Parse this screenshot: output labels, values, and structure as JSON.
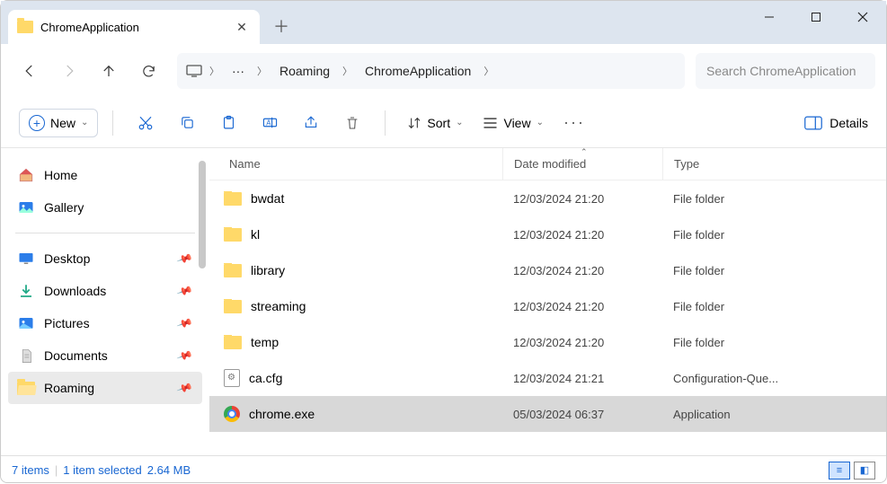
{
  "tab": {
    "title": "ChromeApplication"
  },
  "breadcrumbs": {
    "ellipsis": "···",
    "part1": "Roaming",
    "part2": "ChromeApplication"
  },
  "search": {
    "placeholder": "Search ChromeApplication"
  },
  "toolbar": {
    "new": "New",
    "sort": "Sort",
    "view": "View",
    "details": "Details"
  },
  "sidebar": {
    "home": "Home",
    "gallery": "Gallery",
    "desktop": "Desktop",
    "downloads": "Downloads",
    "pictures": "Pictures",
    "documents": "Documents",
    "roaming": "Roaming"
  },
  "columns": {
    "name": "Name",
    "date": "Date modified",
    "type": "Type"
  },
  "files": [
    {
      "name": "bwdat",
      "date": "12/03/2024 21:20",
      "type": "File folder",
      "icon": "folder",
      "selected": false
    },
    {
      "name": "kl",
      "date": "12/03/2024 21:20",
      "type": "File folder",
      "icon": "folder",
      "selected": false
    },
    {
      "name": "library",
      "date": "12/03/2024 21:20",
      "type": "File folder",
      "icon": "folder",
      "selected": false
    },
    {
      "name": "streaming",
      "date": "12/03/2024 21:20",
      "type": "File folder",
      "icon": "folder",
      "selected": false
    },
    {
      "name": "temp",
      "date": "12/03/2024 21:20",
      "type": "File folder",
      "icon": "folder",
      "selected": false
    },
    {
      "name": "ca.cfg",
      "date": "12/03/2024 21:21",
      "type": "Configuration-Que...",
      "icon": "cfg",
      "selected": false
    },
    {
      "name": "chrome.exe",
      "date": "05/03/2024 06:37",
      "type": "Application",
      "icon": "chrome",
      "selected": true
    }
  ],
  "status": {
    "count": "7 items",
    "selection": "1 item selected",
    "size": "2.64 MB"
  }
}
